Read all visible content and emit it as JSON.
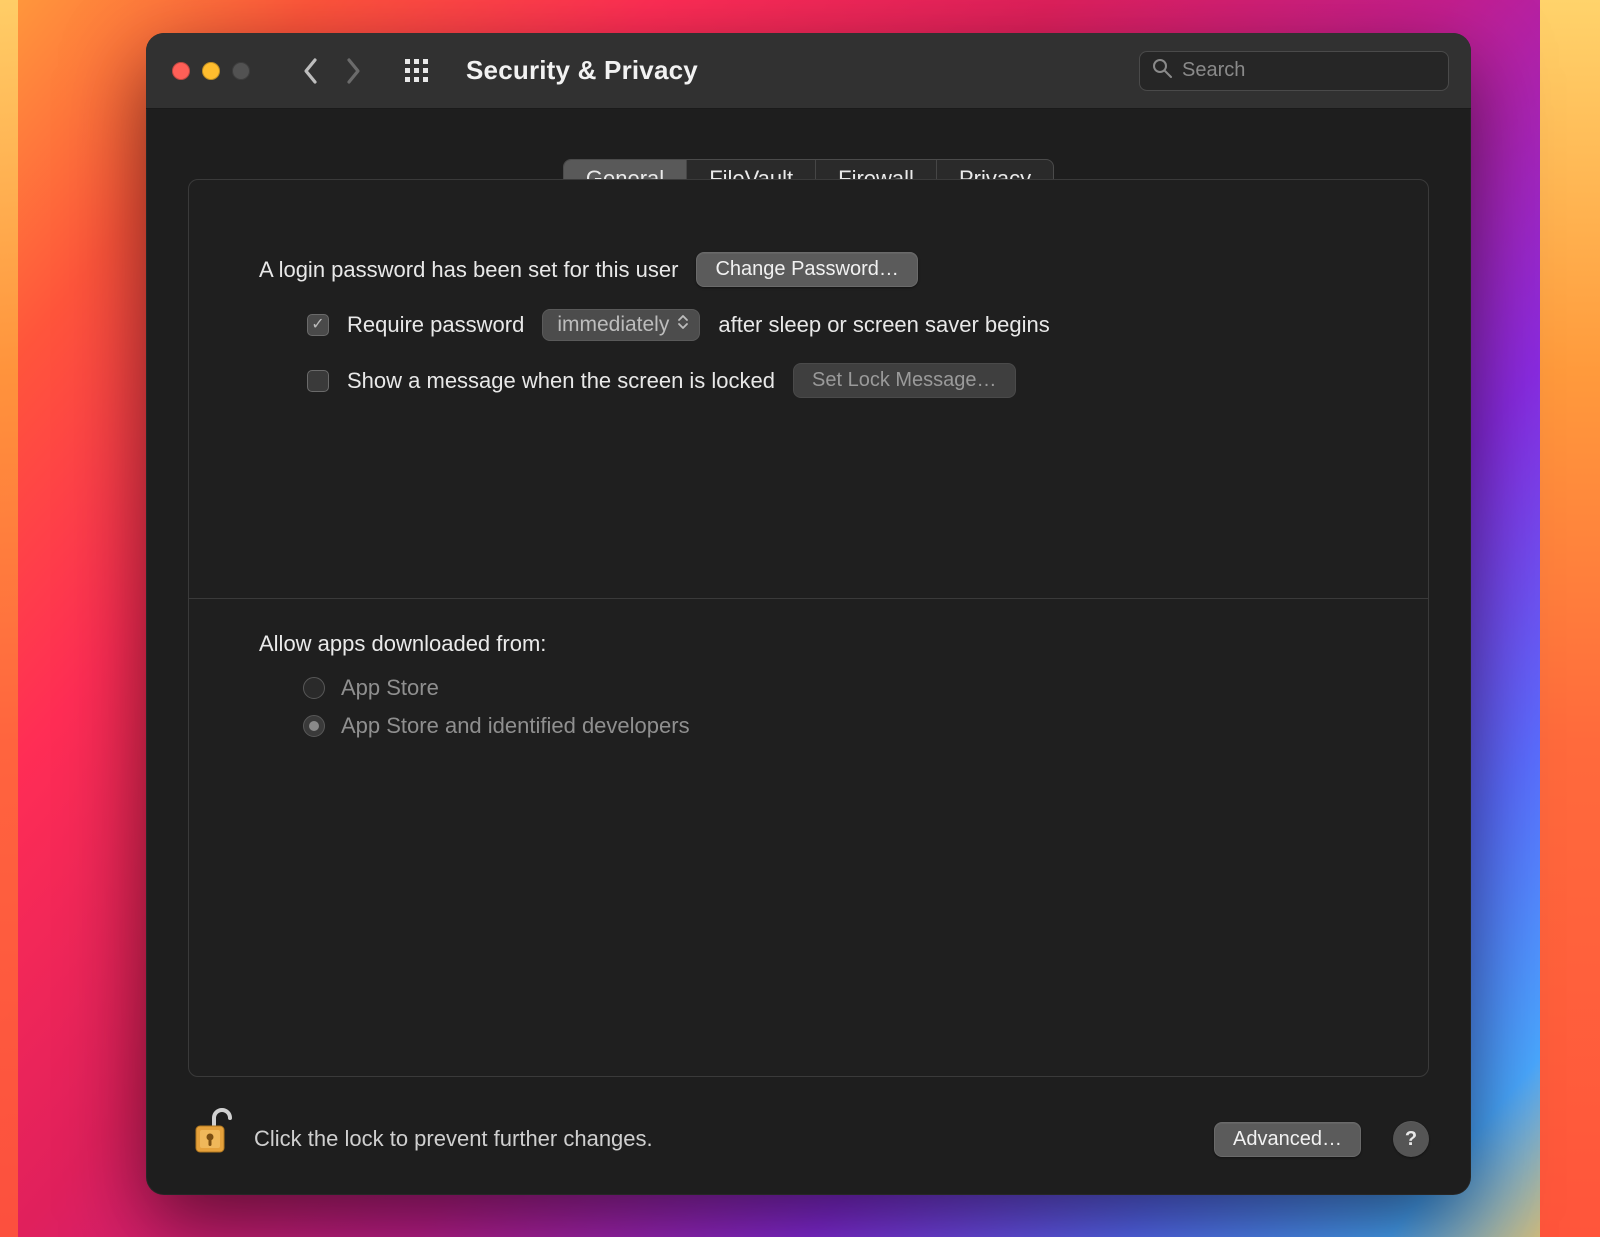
{
  "window": {
    "title": "Security & Privacy"
  },
  "search": {
    "placeholder": "Search",
    "value": ""
  },
  "tabs": {
    "items": [
      "General",
      "FileVault",
      "Firewall",
      "Privacy"
    ],
    "active_index": 0
  },
  "general": {
    "login_password_set_text": "A login password has been set for this user",
    "change_password_button": "Change Password…",
    "require_password": {
      "checked": true,
      "label_before": "Require password",
      "delay_selected": "immediately",
      "label_after": "after sleep or screen saver begins"
    },
    "lock_message": {
      "checked": false,
      "label": "Show a message when the screen is locked",
      "button": "Set Lock Message…",
      "button_enabled": false
    },
    "allow_apps": {
      "title": "Allow apps downloaded from:",
      "options": [
        {
          "label": "App Store",
          "selected": false
        },
        {
          "label": "App Store and identified developers",
          "selected": true
        }
      ],
      "locked": true
    }
  },
  "footer": {
    "lock_state": "unlocked",
    "text": "Click the lock to prevent further changes.",
    "advanced_button": "Advanced…",
    "help": "?"
  }
}
